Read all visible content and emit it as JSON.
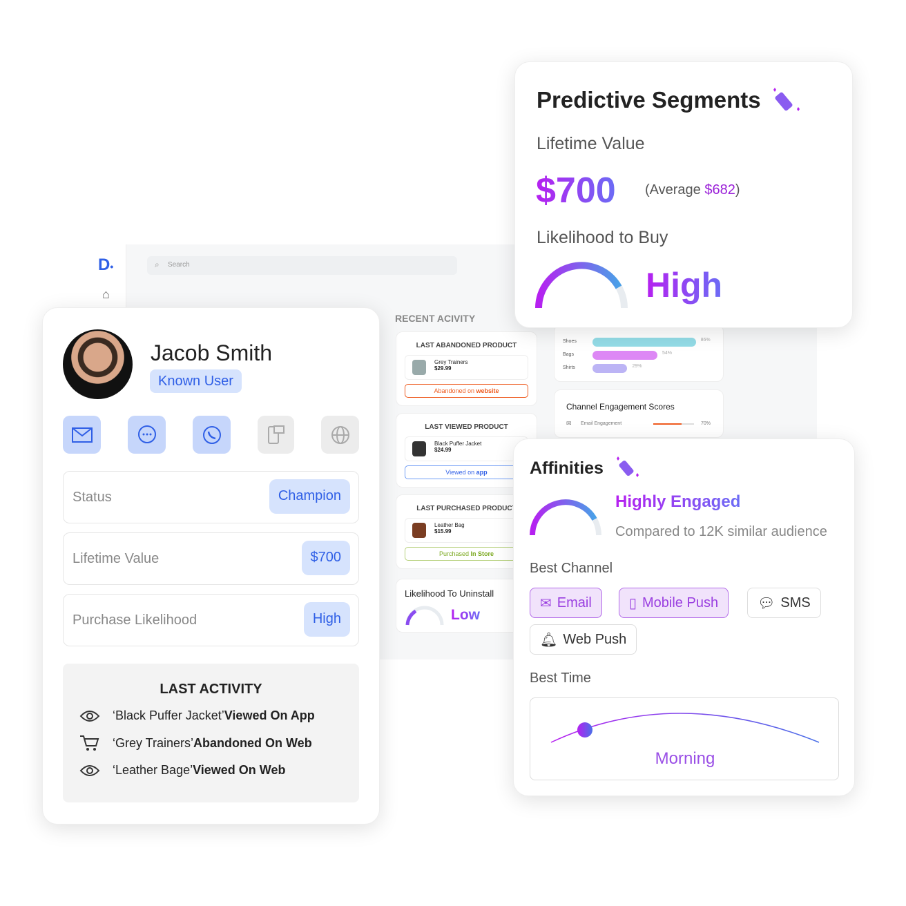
{
  "dashboard": {
    "search_placeholder": "Search",
    "recent_title": "RECENT ACIVITY",
    "abandoned": {
      "title": "LAST ABANDONED PRODUCT",
      "name": "Grey Trainers",
      "price": "$29.99",
      "tag_pre": "Abandoned on ",
      "tag_strong": "website"
    },
    "viewed": {
      "title": "LAST VIEWED PRODUCT",
      "name": "Black Puffer Jacket",
      "price": "$24.99",
      "tag_pre": "Viewed on ",
      "tag_strong": "app"
    },
    "purchased": {
      "title": "LAST PURCHASED PRODUCT",
      "name": "Leather Bag",
      "price": "$15.99",
      "tag_pre": "Purchased ",
      "tag_strong": "In Store"
    },
    "uninstall": {
      "title": "Likelihood To Uninstall",
      "value": "Low"
    },
    "categories": [
      {
        "label": "Shoes",
        "pct": "86%",
        "value": 86,
        "color": "#93dbe6"
      },
      {
        "label": "Bags",
        "pct": "54%",
        "value": 54,
        "color": "#dd88f5"
      },
      {
        "label": "Shirts",
        "pct": "29%",
        "value": 29,
        "color": "#bcb4f5"
      }
    ],
    "channel_scores": {
      "title": "Channel Engagement Scores",
      "item": "Email Engagement",
      "pct": "70%",
      "value": 70
    }
  },
  "profile": {
    "name": "Jacob Smith",
    "badge": "Known User",
    "channels": [
      "email-icon",
      "chat-icon",
      "whatsapp-icon",
      "mobile-push-icon",
      "web-push-icon"
    ],
    "rows": [
      {
        "label": "Status",
        "value": "Champion"
      },
      {
        "label": "Lifetime Value",
        "value": "$700"
      },
      {
        "label": "Purchase Likelihood",
        "value": "High"
      }
    ],
    "last_activity": {
      "title": "LAST ACTIVITY",
      "items": [
        {
          "icon": "eye-icon",
          "item": "‘Black Puffer Jacket’ ",
          "action": "Viewed On App"
        },
        {
          "icon": "cart-icon",
          "item": "‘Grey Trainers’ ",
          "action": "Abandoned On Web"
        },
        {
          "icon": "eye-icon",
          "item": "‘Leather Bage’ ",
          "action": "Viewed On Web"
        }
      ]
    }
  },
  "segments": {
    "title": "Predictive Segments",
    "ltv_label": "Lifetime Value",
    "ltv": "$700",
    "avg_pre": "(Average ",
    "avg": "$682",
    "avg_post": ")",
    "buy_label": "Likelihood to Buy",
    "buy": "High"
  },
  "affinities": {
    "title": "Affinities",
    "level": "Highly Engaged",
    "compare": "Compared to 12K similar audience",
    "channel_label": "Best Channel",
    "channels": [
      {
        "label": "Email",
        "selected": true
      },
      {
        "label": "Mobile Push",
        "selected": true
      },
      {
        "label": "SMS",
        "selected": false
      },
      {
        "label": "Web Push",
        "selected": false
      }
    ],
    "time_label": "Best Time",
    "time": "Morning"
  },
  "colors": {
    "accent": "#b620f0",
    "blue": "#2f5fe6",
    "orange": "#ee5a1e",
    "green": "#7aa81e"
  }
}
